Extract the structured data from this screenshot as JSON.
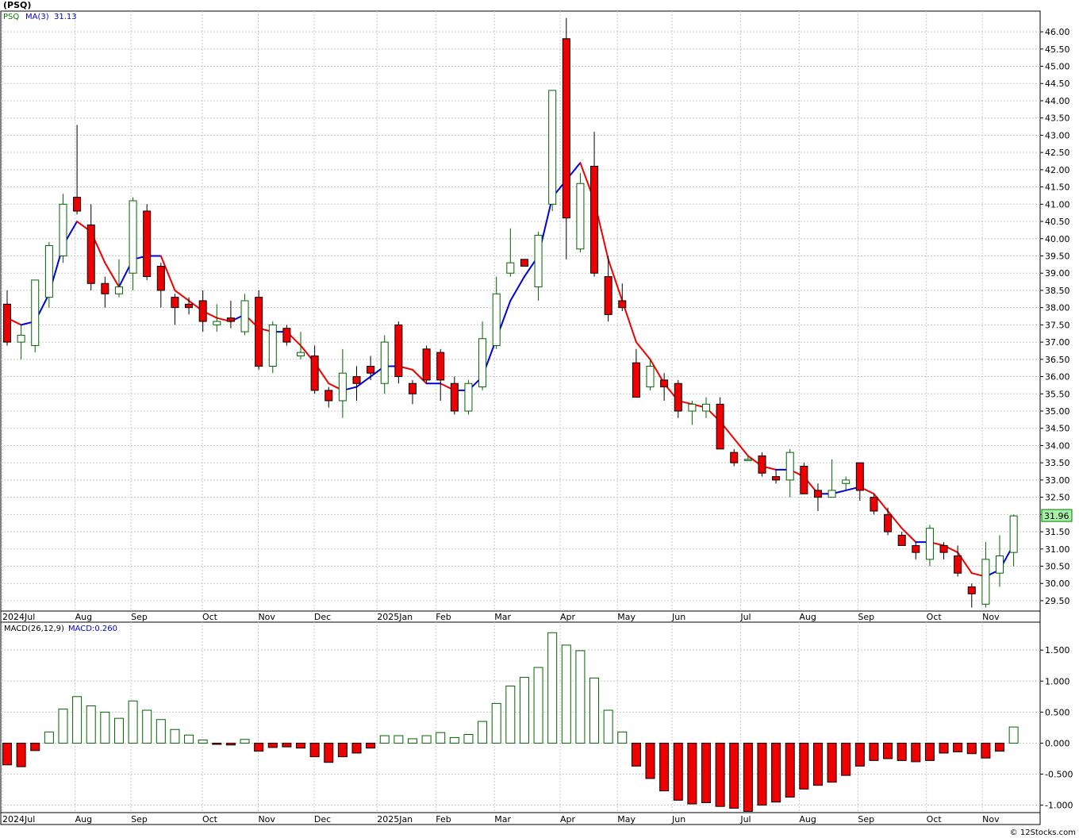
{
  "chart_data": [
    {
      "type": "candlestick",
      "title": "(PSQ)",
      "legend": {
        "symbol": "PSQ",
        "ma_label": "MA(3)",
        "ma_value": "31.13",
        "symbol_color": "#008000",
        "ma_color": "#0000cc"
      },
      "last_price_label": "31.96",
      "ylim": [
        29.2,
        46.6
      ],
      "y_ticks": [
        "29.50",
        "30.00",
        "30.50",
        "31.00",
        "31.50",
        "32.00",
        "32.50",
        "33.00",
        "33.50",
        "34.00",
        "34.50",
        "35.00",
        "35.50",
        "36.00",
        "36.50",
        "37.00",
        "37.50",
        "38.00",
        "38.50",
        "39.00",
        "39.50",
        "40.00",
        "40.50",
        "41.00",
        "41.50",
        "42.00",
        "42.50",
        "43.00",
        "43.50",
        "44.00",
        "44.50",
        "45.00",
        "45.50",
        "46.00"
      ],
      "x_labels": [
        "2024Jul",
        "Aug",
        "Sep",
        "Oct",
        "Nov",
        "Dec",
        "2025Jan",
        "Feb",
        "Mar",
        "Apr",
        "May",
        "Jun",
        "Jul",
        "Aug",
        "Sep",
        "Oct",
        "Nov"
      ],
      "x_label_weeks": [
        0,
        5.2,
        9.2,
        14.3,
        18.3,
        22.3,
        26.8,
        31,
        35.2,
        39.9,
        44,
        47.9,
        52.8,
        57.0,
        61.2,
        66.1,
        70.1
      ],
      "candles": [
        {
          "o": 38.1,
          "h": 38.5,
          "l": 36.9,
          "c": 37.0
        },
        {
          "o": 37.0,
          "h": 37.5,
          "l": 36.5,
          "c": 37.2
        },
        {
          "o": 36.9,
          "h": 37.9,
          "l": 36.7,
          "c": 38.8
        },
        {
          "o": 38.3,
          "h": 39.9,
          "l": 38.0,
          "c": 39.8
        },
        {
          "o": 39.5,
          "h": 41.3,
          "l": 39.3,
          "c": 41.0
        },
        {
          "o": 41.2,
          "h": 43.3,
          "l": 40.7,
          "c": 40.8
        },
        {
          "o": 40.4,
          "h": 41.0,
          "l": 38.5,
          "c": 38.7
        },
        {
          "o": 38.7,
          "h": 38.9,
          "l": 38.0,
          "c": 38.4
        },
        {
          "o": 38.4,
          "h": 39.4,
          "l": 38.3,
          "c": 38.6
        },
        {
          "o": 39.0,
          "h": 41.2,
          "l": 38.5,
          "c": 41.1
        },
        {
          "o": 40.8,
          "h": 41.0,
          "l": 38.8,
          "c": 38.9
        },
        {
          "o": 39.2,
          "h": 39.3,
          "l": 38.0,
          "c": 38.5
        },
        {
          "o": 38.3,
          "h": 38.4,
          "l": 37.5,
          "c": 38.0
        },
        {
          "o": 38.1,
          "h": 38.3,
          "l": 37.8,
          "c": 38.0
        },
        {
          "o": 38.2,
          "h": 38.5,
          "l": 37.3,
          "c": 37.6
        },
        {
          "o": 37.5,
          "h": 38.1,
          "l": 37.3,
          "c": 37.6
        },
        {
          "o": 37.7,
          "h": 38.2,
          "l": 37.4,
          "c": 37.6
        },
        {
          "o": 37.3,
          "h": 38.4,
          "l": 37.2,
          "c": 38.2
        },
        {
          "o": 38.3,
          "h": 38.5,
          "l": 36.2,
          "c": 36.3
        },
        {
          "o": 36.3,
          "h": 37.6,
          "l": 36.1,
          "c": 37.5
        },
        {
          "o": 37.4,
          "h": 37.5,
          "l": 36.9,
          "c": 37.0
        },
        {
          "o": 36.6,
          "h": 37.3,
          "l": 36.5,
          "c": 36.7
        },
        {
          "o": 36.6,
          "h": 36.9,
          "l": 35.5,
          "c": 35.6
        },
        {
          "o": 35.6,
          "h": 35.7,
          "l": 35.1,
          "c": 35.3
        },
        {
          "o": 35.3,
          "h": 36.8,
          "l": 34.8,
          "c": 36.1
        },
        {
          "o": 36.0,
          "h": 36.3,
          "l": 35.3,
          "c": 35.8
        },
        {
          "o": 36.3,
          "h": 36.6,
          "l": 35.9,
          "c": 36.1
        },
        {
          "o": 35.8,
          "h": 37.2,
          "l": 35.5,
          "c": 37.0
        },
        {
          "o": 37.5,
          "h": 37.6,
          "l": 35.8,
          "c": 36.0
        },
        {
          "o": 35.8,
          "h": 35.9,
          "l": 35.2,
          "c": 35.5
        },
        {
          "o": 36.8,
          "h": 36.9,
          "l": 35.8,
          "c": 35.9
        },
        {
          "o": 36.7,
          "h": 36.8,
          "l": 35.3,
          "c": 35.9
        },
        {
          "o": 35.8,
          "h": 36.0,
          "l": 34.9,
          "c": 35.0
        },
        {
          "o": 35.0,
          "h": 35.9,
          "l": 34.9,
          "c": 35.8
        },
        {
          "o": 35.7,
          "h": 37.6,
          "l": 35.6,
          "c": 37.1
        },
        {
          "o": 36.9,
          "h": 38.9,
          "l": 36.8,
          "c": 38.4
        },
        {
          "o": 39.0,
          "h": 40.3,
          "l": 38.9,
          "c": 39.3
        },
        {
          "o": 39.4,
          "h": 39.4,
          "l": 39.2,
          "c": 39.2
        },
        {
          "o": 38.6,
          "h": 40.2,
          "l": 38.2,
          "c": 40.1
        },
        {
          "o": 41.0,
          "h": 44.3,
          "l": 40.8,
          "c": 44.3
        },
        {
          "o": 45.8,
          "h": 46.4,
          "l": 39.4,
          "c": 40.6
        },
        {
          "o": 39.7,
          "h": 41.9,
          "l": 39.6,
          "c": 41.6
        },
        {
          "o": 42.1,
          "h": 43.1,
          "l": 38.9,
          "c": 39.0
        },
        {
          "o": 38.9,
          "h": 39.5,
          "l": 37.6,
          "c": 37.8
        },
        {
          "o": 38.2,
          "h": 38.7,
          "l": 37.9,
          "c": 38.0
        },
        {
          "o": 36.4,
          "h": 36.8,
          "l": 35.4,
          "c": 35.4
        },
        {
          "o": 35.7,
          "h": 36.5,
          "l": 35.6,
          "c": 36.3
        },
        {
          "o": 35.9,
          "h": 36.1,
          "l": 35.3,
          "c": 35.7
        },
        {
          "o": 35.8,
          "h": 35.9,
          "l": 34.8,
          "c": 35.0
        },
        {
          "o": 35.0,
          "h": 35.3,
          "l": 34.6,
          "c": 35.2
        },
        {
          "o": 35.0,
          "h": 35.4,
          "l": 34.8,
          "c": 35.2
        },
        {
          "o": 35.2,
          "h": 35.4,
          "l": 33.9,
          "c": 33.9
        },
        {
          "o": 33.8,
          "h": 33.9,
          "l": 33.4,
          "c": 33.5
        },
        {
          "o": 33.6,
          "h": 33.7,
          "l": 33.6,
          "c": 33.6
        },
        {
          "o": 33.7,
          "h": 33.8,
          "l": 33.1,
          "c": 33.2
        },
        {
          "o": 33.1,
          "h": 33.3,
          "l": 32.9,
          "c": 33.0
        },
        {
          "o": 33.0,
          "h": 33.9,
          "l": 32.5,
          "c": 33.8
        },
        {
          "o": 33.4,
          "h": 33.5,
          "l": 32.6,
          "c": 32.6
        },
        {
          "o": 32.7,
          "h": 32.9,
          "l": 32.1,
          "c": 32.5
        },
        {
          "o": 32.5,
          "h": 33.6,
          "l": 32.5,
          "c": 32.7
        },
        {
          "o": 32.9,
          "h": 33.1,
          "l": 32.7,
          "c": 33.0
        },
        {
          "o": 33.5,
          "h": 33.5,
          "l": 32.4,
          "c": 32.7
        },
        {
          "o": 32.5,
          "h": 32.6,
          "l": 32.0,
          "c": 32.1
        },
        {
          "o": 32.0,
          "h": 32.2,
          "l": 31.4,
          "c": 31.5
        },
        {
          "o": 31.4,
          "h": 31.5,
          "l": 31.1,
          "c": 31.1
        },
        {
          "o": 31.1,
          "h": 31.2,
          "l": 30.7,
          "c": 30.9
        },
        {
          "o": 30.7,
          "h": 31.7,
          "l": 30.5,
          "c": 31.6
        },
        {
          "o": 31.1,
          "h": 31.2,
          "l": 30.7,
          "c": 30.9
        },
        {
          "o": 30.8,
          "h": 31.1,
          "l": 30.2,
          "c": 30.3
        },
        {
          "o": 29.9,
          "h": 30.0,
          "l": 29.3,
          "c": 29.7
        },
        {
          "o": 29.4,
          "h": 31.2,
          "l": 29.3,
          "c": 30.7
        },
        {
          "o": 30.3,
          "h": 31.4,
          "l": 29.9,
          "c": 30.8
        },
        {
          "o": 30.9,
          "h": 32.0,
          "l": 30.5,
          "c": 31.96
        }
      ],
      "ma3": [
        37.7,
        37.5,
        37.6,
        38.4,
        39.8,
        40.5,
        40.2,
        39.3,
        38.6,
        39.4,
        39.5,
        39.5,
        38.5,
        38.2,
        37.9,
        37.7,
        37.6,
        37.8,
        37.4,
        37.3,
        37.3,
        36.9,
        36.4,
        35.8,
        35.6,
        35.7,
        36.0,
        36.3,
        36.3,
        36.2,
        35.8,
        35.8,
        35.6,
        35.6,
        36.0,
        37.1,
        38.2,
        38.9,
        39.5,
        41.2,
        41.7,
        42.2,
        41.1,
        39.4,
        38.2,
        37.0,
        36.5,
        35.8,
        35.3,
        35.2,
        35.1,
        34.7,
        34.2,
        33.7,
        33.4,
        33.3,
        33.3,
        33.1,
        32.6,
        32.6,
        32.7,
        32.8,
        32.6,
        32.1,
        31.6,
        31.2,
        31.2,
        31.1,
        30.9,
        30.3,
        30.2,
        30.4,
        31.13
      ]
    },
    {
      "type": "bar",
      "title": "MACD(26,12,9)",
      "legend_value_label": "MACD:0.260",
      "legend_value_color": "#0000cc",
      "ylim": [
        -1.12,
        1.95
      ],
      "y_ticks": [
        "1.500",
        "1.000",
        "0.500",
        "0.000",
        "-0.500",
        "-1.000"
      ],
      "x_labels": [
        "2024Jul",
        "Aug",
        "Sep",
        "Oct",
        "Nov",
        "Dec",
        "2025Jan",
        "Feb",
        "Mar",
        "Apr",
        "May",
        "Jun",
        "Jul",
        "Aug",
        "Sep",
        "Oct",
        "Nov"
      ],
      "values": [
        -0.35,
        -0.38,
        -0.12,
        0.18,
        0.55,
        0.75,
        0.6,
        0.5,
        0.4,
        0.68,
        0.53,
        0.38,
        0.22,
        0.13,
        0.05,
        -0.02,
        -0.03,
        0.06,
        -0.13,
        -0.07,
        -0.06,
        -0.08,
        -0.22,
        -0.31,
        -0.22,
        -0.16,
        -0.08,
        0.12,
        0.12,
        0.07,
        0.12,
        0.17,
        0.09,
        0.14,
        0.35,
        0.64,
        0.92,
        1.06,
        1.22,
        1.78,
        1.58,
        1.49,
        1.05,
        0.53,
        0.18,
        -0.37,
        -0.57,
        -0.77,
        -0.92,
        -0.98,
        -0.96,
        -1.02,
        -1.05,
        -1.1,
        -1.0,
        -0.95,
        -0.87,
        -0.74,
        -0.68,
        -0.63,
        -0.52,
        -0.37,
        -0.28,
        -0.25,
        -0.28,
        -0.3,
        -0.28,
        -0.16,
        -0.14,
        -0.17,
        -0.24,
        -0.13,
        0.26
      ]
    }
  ],
  "footer": {
    "copyright": "© 12Stocks.com"
  }
}
